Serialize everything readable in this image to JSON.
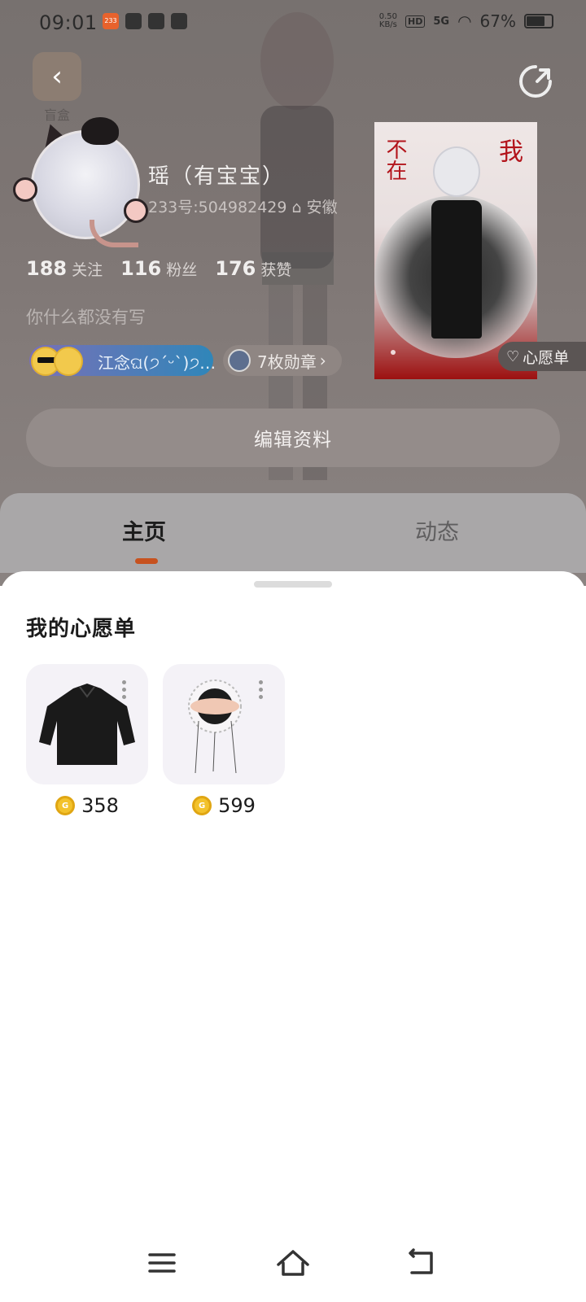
{
  "status_bar": {
    "time": "09:01",
    "app_badge": "233",
    "net_speed": "0.50\nKB/s",
    "hd": "HD",
    "signal": "5G",
    "battery": "67%"
  },
  "header": {
    "blind_box_label": "盲盒",
    "back_icon": "back-arrow-icon",
    "share_icon": "share-icon"
  },
  "profile": {
    "name": "瑶（有宝宝）",
    "uid_line": "233号:504982429 ⌂ 安徽",
    "stats": [
      {
        "value": "188",
        "label": "关注"
      },
      {
        "value": "116",
        "label": "粉丝"
      },
      {
        "value": "176",
        "label": "获赞"
      }
    ],
    "bio": "你什么都没有写",
    "friend_chip": "江念ଘ(੭ˊᵕˋ)੭…",
    "badges": "7枚勋章",
    "wishlist_chip": "心愿单",
    "edit_button": "编辑资料"
  },
  "tabs": [
    {
      "label": "主页",
      "active": true
    },
    {
      "label": "动态",
      "active": false
    }
  ],
  "wishlist": {
    "title": "我的心愿单",
    "items": [
      {
        "name": "black-shirt",
        "price": "358"
      },
      {
        "name": "hand-accessory",
        "price": "599"
      }
    ]
  },
  "colors": {
    "accent": "#c7521f",
    "coin": "#f3c22b"
  }
}
